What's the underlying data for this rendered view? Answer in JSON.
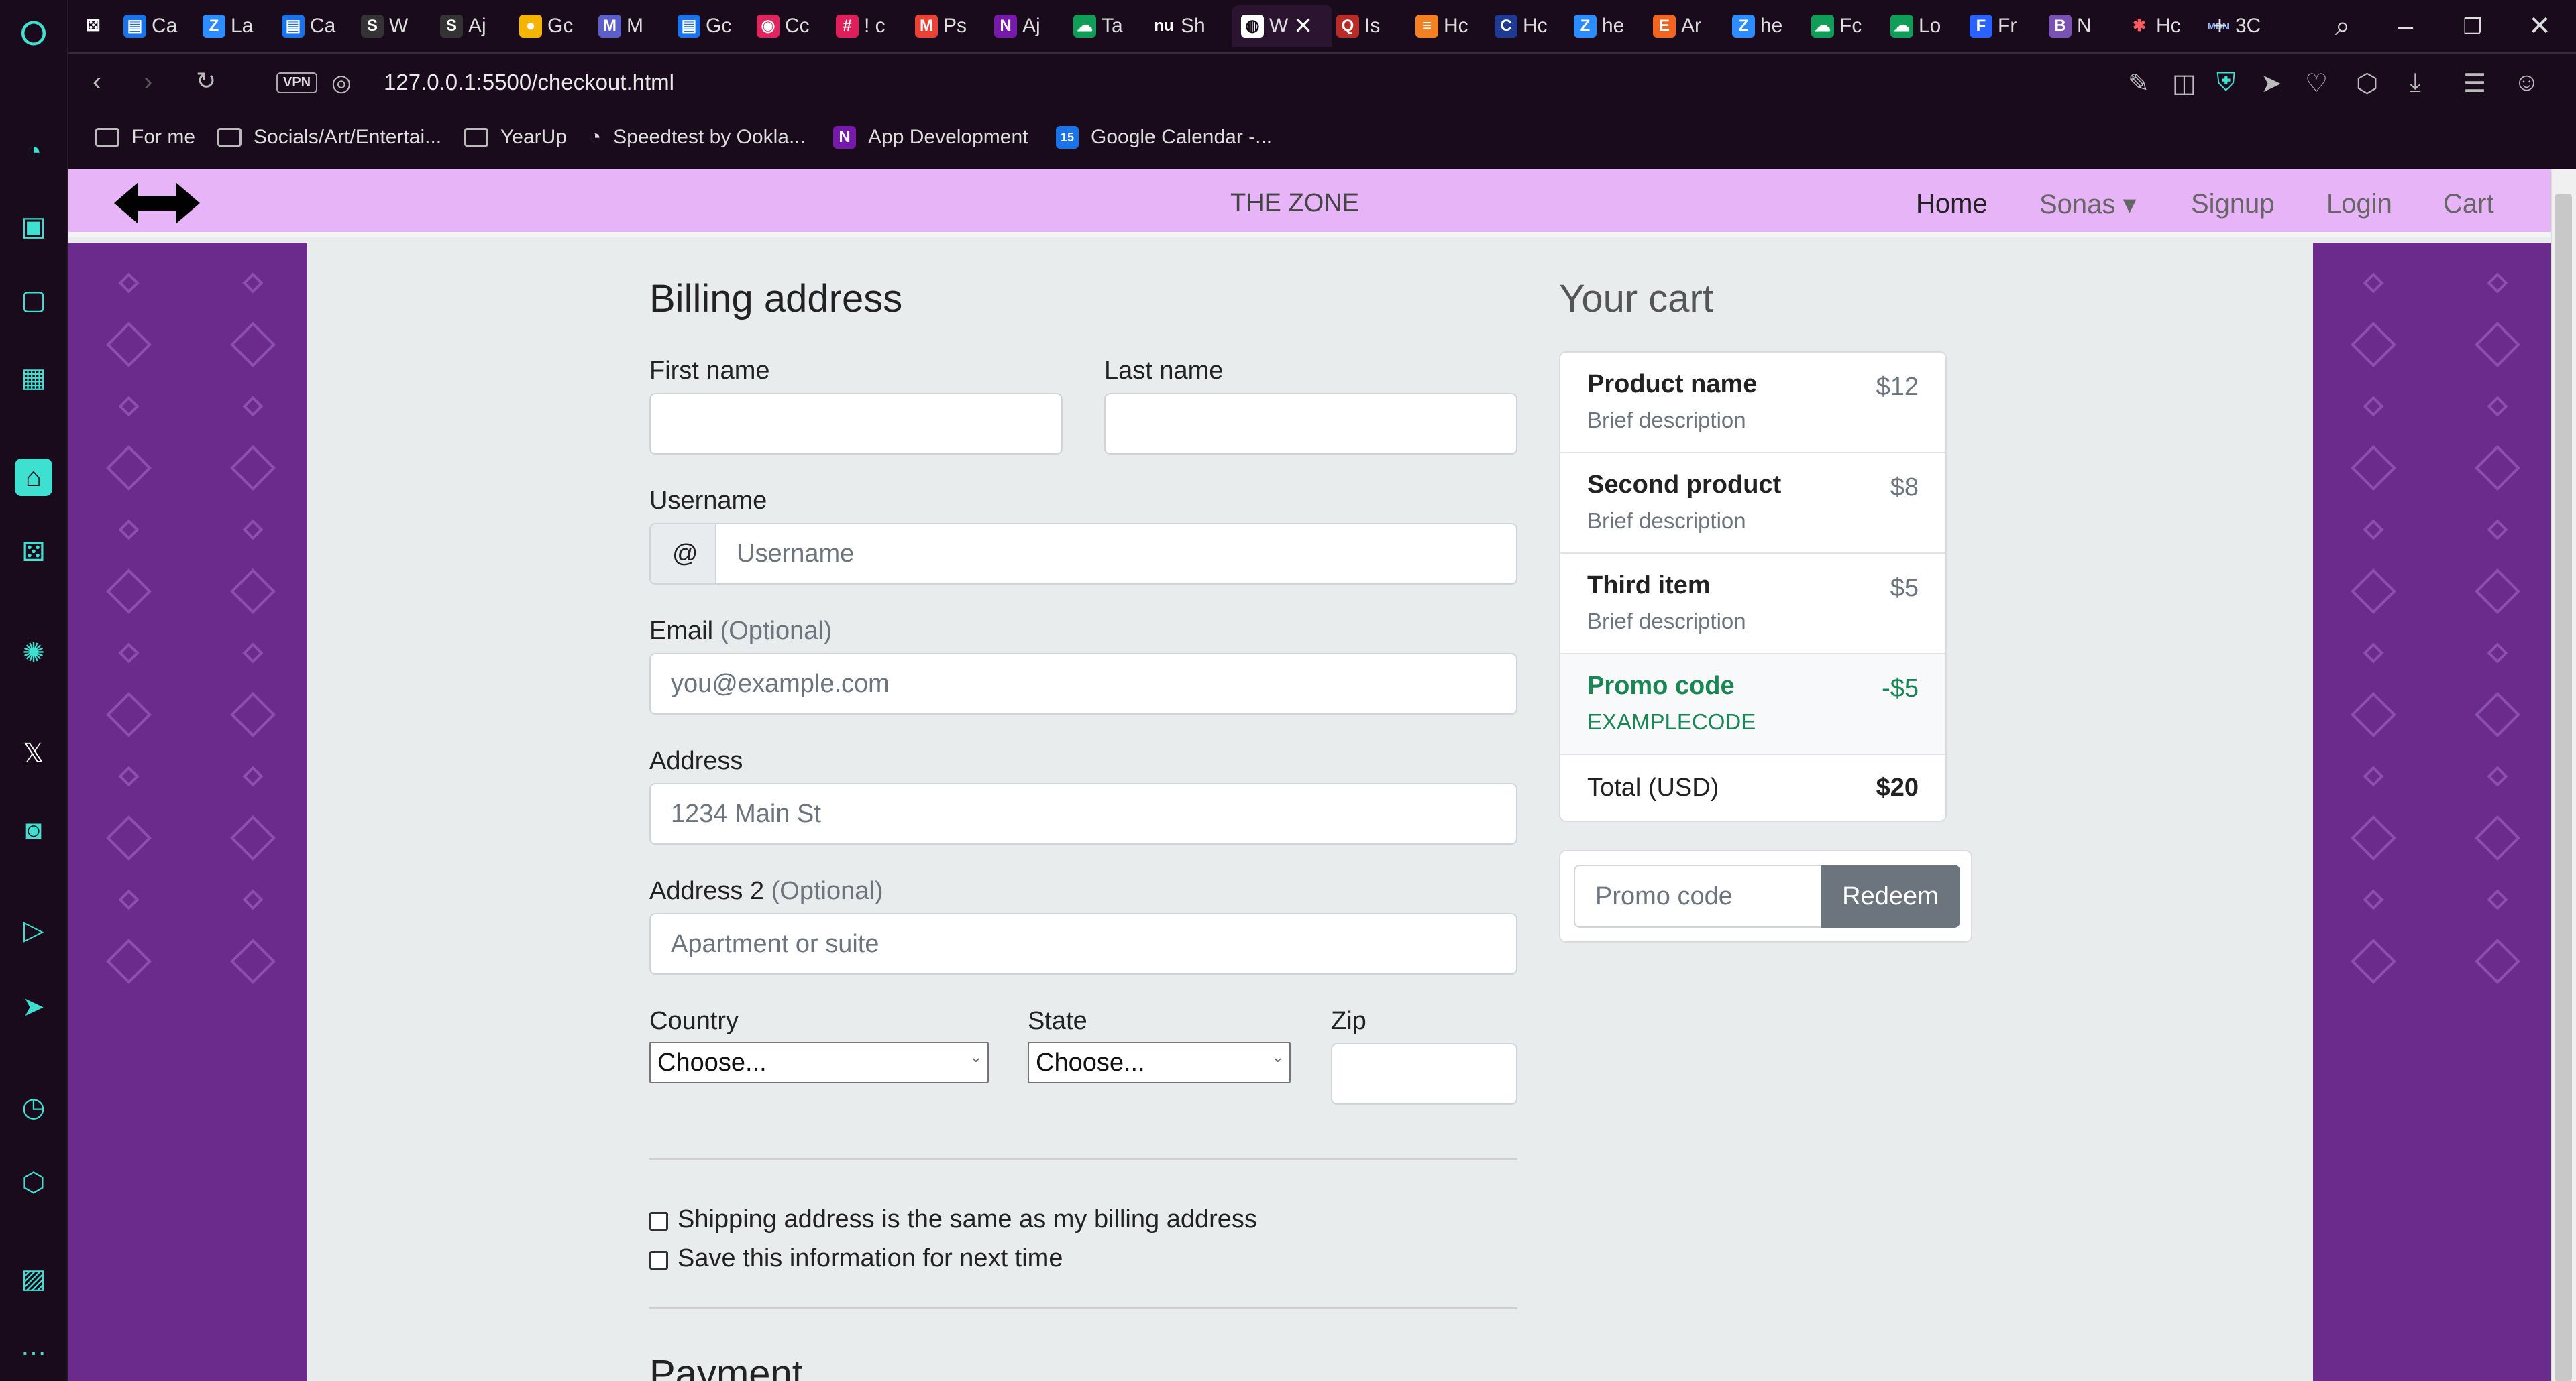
{
  "browser": {
    "tabs": [
      {
        "icon": "gamepad-icon",
        "label": ""
      },
      {
        "icon": "calendar-icon",
        "label": "Ca"
      },
      {
        "icon": "z-icon",
        "label": "La"
      },
      {
        "icon": "calendar-icon",
        "label": "Ca"
      },
      {
        "icon": "s-icon",
        "label": "W"
      },
      {
        "icon": "s-icon",
        "label": "Aj"
      },
      {
        "icon": "bulb-icon",
        "label": "Gc"
      },
      {
        "icon": "m-icon",
        "label": "M"
      },
      {
        "icon": "calendar-icon",
        "label": "Gc"
      },
      {
        "icon": "record-icon",
        "label": "Cc"
      },
      {
        "icon": "slack-icon",
        "label": "! c"
      },
      {
        "icon": "gmail-icon",
        "label": "Ps"
      },
      {
        "icon": "onenote-icon",
        "label": "Aj"
      },
      {
        "icon": "cloud-icon",
        "label": "Ta"
      },
      {
        "icon": "nu-icon",
        "label": "Sh"
      },
      {
        "icon": "globe-icon",
        "label": "W",
        "active": true
      },
      {
        "icon": "q-icon",
        "label": "Is"
      },
      {
        "icon": "stack-icon",
        "label": "Hc"
      },
      {
        "icon": "c-icon",
        "label": "Hc"
      },
      {
        "icon": "z-icon",
        "label": "he"
      },
      {
        "icon": "e-icon",
        "label": "Ar"
      },
      {
        "icon": "z-icon",
        "label": "he"
      },
      {
        "icon": "cloud-icon",
        "label": "Fc"
      },
      {
        "icon": "cloud-icon",
        "label": "Lo"
      },
      {
        "icon": "f-icon",
        "label": "Fr"
      },
      {
        "icon": "b-icon",
        "label": "N"
      },
      {
        "icon": "asterisk-icon",
        "label": "Hc"
      },
      {
        "icon": "mdn-icon",
        "label": "3C"
      }
    ],
    "active_tab_close": "✕",
    "new_tab": "+",
    "url": "127.0.0.1:5500/checkout.html",
    "vpn_label": "VPN",
    "bookmarks": [
      {
        "icon": "folder-icon",
        "label": "For me"
      },
      {
        "icon": "folder-icon",
        "label": "Socials/Art/Entertai..."
      },
      {
        "icon": "folder-icon",
        "label": "YearUp"
      },
      {
        "icon": "speedtest-icon",
        "label": "Speedtest by Ookla..."
      },
      {
        "icon": "onenote-icon",
        "label": "App Development"
      },
      {
        "icon": "calendar-icon",
        "label": "Google Calendar -..."
      }
    ]
  },
  "site_nav": {
    "brand": "THE ZONE",
    "links": [
      "Home",
      "Sonas",
      "Signup",
      "Login",
      "Cart"
    ],
    "dropdown_caret": "▾"
  },
  "billing": {
    "heading": "Billing address",
    "first_name_label": "First name",
    "last_name_label": "Last name",
    "username_label": "Username",
    "username_prefix": "@",
    "username_placeholder": "Username",
    "email_label": "Email",
    "email_optional": "(Optional)",
    "email_placeholder": "you@example.com",
    "address_label": "Address",
    "address_placeholder": "1234 Main St",
    "address2_label": "Address 2",
    "address2_optional": "(Optional)",
    "address2_placeholder": "Apartment or suite",
    "country_label": "Country",
    "country_value": "Choose...",
    "state_label": "State",
    "state_value": "Choose...",
    "zip_label": "Zip",
    "same_address_label": "Shipping address is the same as my billing address",
    "save_info_label": "Save this information for next time",
    "payment_heading": "Payment"
  },
  "cart": {
    "heading": "Your cart",
    "items": [
      {
        "name": "Product name",
        "desc": "Brief description",
        "price": "$12"
      },
      {
        "name": "Second product",
        "desc": "Brief description",
        "price": "$8"
      },
      {
        "name": "Third item",
        "desc": "Brief description",
        "price": "$5"
      }
    ],
    "promo": {
      "name": "Promo code",
      "code": "EXAMPLECODE",
      "amount": "-$5"
    },
    "total_label": "Total (USD)",
    "total_value": "$20",
    "promo_placeholder": "Promo code",
    "redeem_label": "Redeem"
  },
  "colors": {
    "navbar": "#e8b4f8",
    "side_panels": "#6a2b8c",
    "promo_green": "#198754",
    "redeem_button": "#6c757d"
  }
}
